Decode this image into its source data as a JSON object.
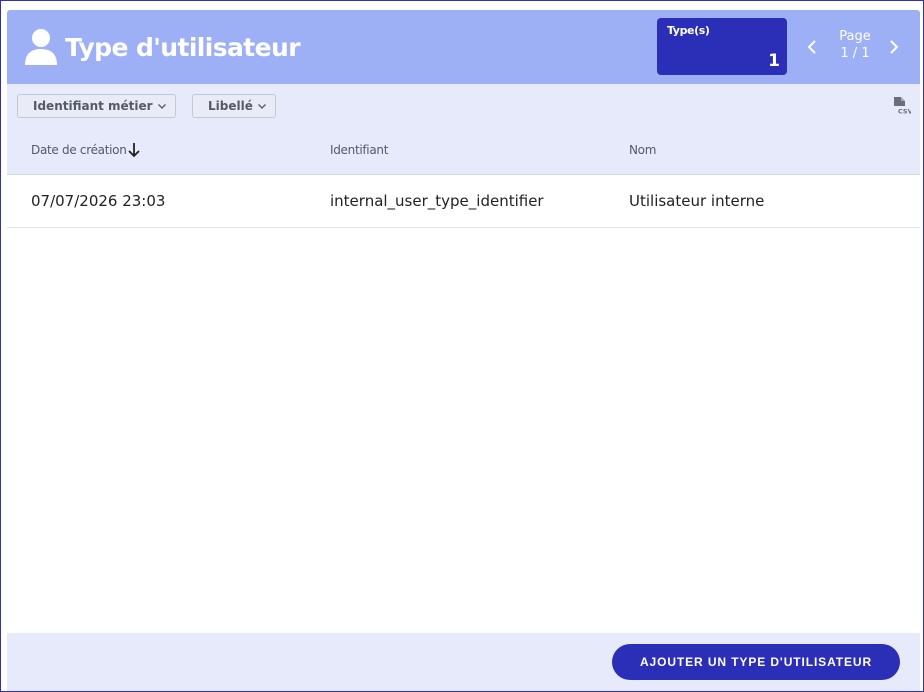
{
  "header": {
    "title": "Type d'utilisateur",
    "title_icon": "user-icon",
    "count_label": "Type(s)",
    "count_value": "1",
    "pager": {
      "label": "Page",
      "value": "1 / 1"
    }
  },
  "filters": [
    {
      "label": "Identifiant métier"
    },
    {
      "label": "Libellé"
    }
  ],
  "export_icon": "csv-file-icon",
  "table": {
    "columns": [
      {
        "label": "Date de création",
        "sort": "descending"
      },
      {
        "label": "Identifiant"
      },
      {
        "label": "Nom"
      }
    ],
    "rows": [
      {
        "created": "07/07/2026 23:03",
        "identifier": "internal_user_type_identifier",
        "name": "Utilisateur interne"
      }
    ]
  },
  "footer": {
    "add_button_label": "AJOUTER UN TYPE D'UTILISATEUR"
  },
  "colors": {
    "header_bg": "#9db0f5",
    "panel_bg": "#e6eafb",
    "accent": "#2b2fb8",
    "frame_border": "#2f2fbf"
  }
}
